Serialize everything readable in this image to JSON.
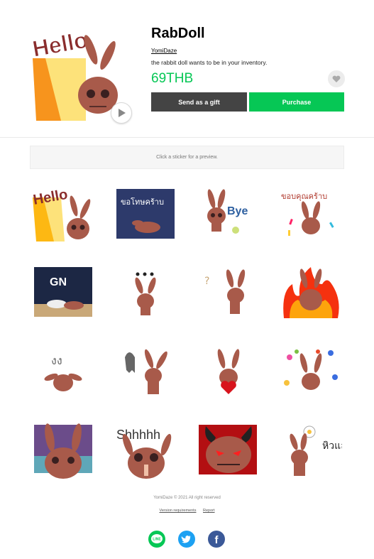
{
  "product": {
    "title": "RabDoll",
    "author": "YomiDaze",
    "description": "the rabbit doll wants to be in your inventory.",
    "price": "69THB",
    "price_color": "#06c755"
  },
  "main_sticker": {
    "text": "Hello",
    "icon": "rabbit-doll-hello-sticker"
  },
  "buttons": {
    "gift_label": "Send as a gift",
    "purchase_label": "Purchase",
    "gift_color": "#444444",
    "purchase_color": "#06c755"
  },
  "preview": {
    "text": "Click a sticker for a preview."
  },
  "stickers": [
    {
      "name": "sticker-hello",
      "text": "Hello"
    },
    {
      "name": "sticker-apology",
      "text": "ขอโทษคร้าบ"
    },
    {
      "name": "sticker-bye",
      "text": "Bye"
    },
    {
      "name": "sticker-thank-you",
      "text": "ขอบคุณคร้าบ"
    },
    {
      "name": "sticker-good-night",
      "text": "GN"
    },
    {
      "name": "sticker-thinking",
      "text": ""
    },
    {
      "name": "sticker-confused",
      "text": ""
    },
    {
      "name": "sticker-angry-fire",
      "text": ""
    },
    {
      "name": "sticker-whatever",
      "text": "งง"
    },
    {
      "name": "sticker-ghost",
      "text": ""
    },
    {
      "name": "sticker-love",
      "text": ""
    },
    {
      "name": "sticker-flowers",
      "text": ""
    },
    {
      "name": "sticker-sad",
      "text": ""
    },
    {
      "name": "sticker-shhh",
      "text": "Shhhhh"
    },
    {
      "name": "sticker-devil",
      "text": ""
    },
    {
      "name": "sticker-hungry",
      "text": "หิวแล้ว"
    }
  ],
  "footer": {
    "copyright": "YomiDaze © 2021 All right reserved",
    "version_link": "Version requirements",
    "report_link": "Report"
  },
  "share": {
    "line": {
      "label": "LINE",
      "color": "#06c755"
    },
    "twitter": {
      "color": "#1da1f2"
    },
    "facebook": {
      "label": "f",
      "color": "#3b5998"
    }
  }
}
